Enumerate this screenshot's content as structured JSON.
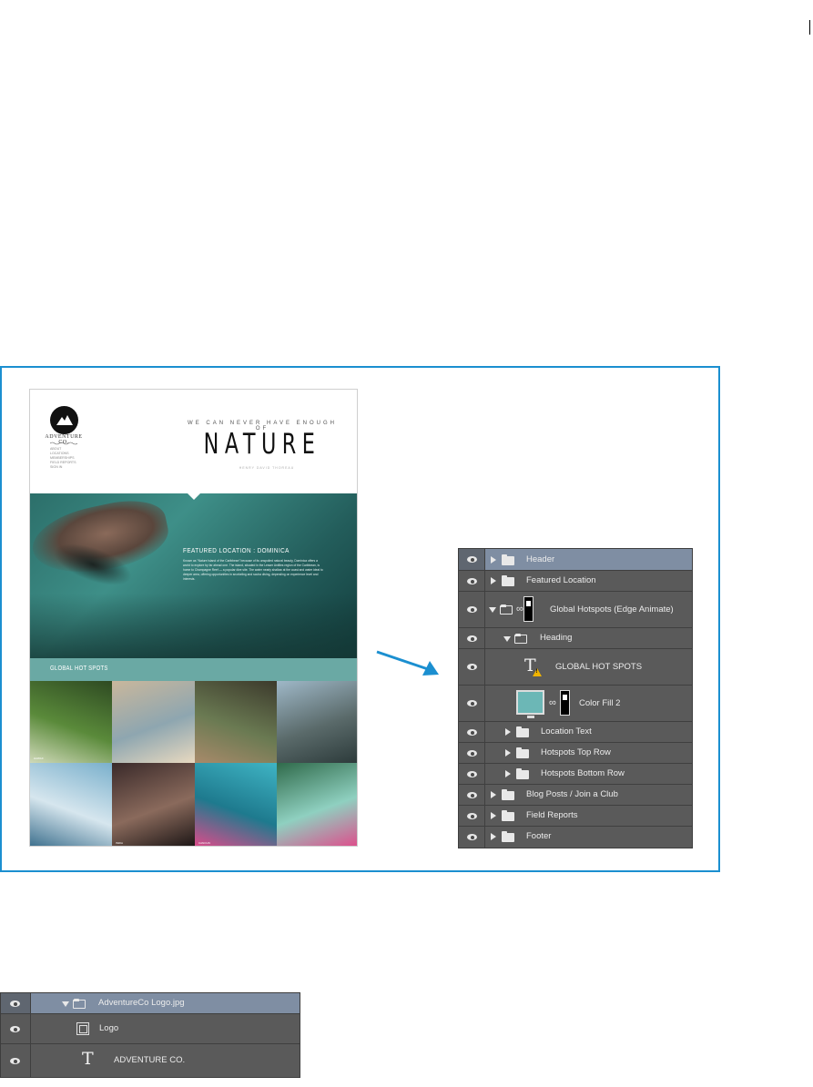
{
  "mockup": {
    "brand": "ADVENTURE CO.",
    "nav": [
      "ABOUT",
      "LOCATIONS",
      "MEMBERSHIPS",
      "FIELD REPORTS",
      "SIGN IN"
    ],
    "tagline": "WE CAN NEVER HAVE ENOUGH OF",
    "title": "NATURE",
    "subtitle": "HENRY DAVID THOREAU",
    "featured_title": "FEATURED LOCATION : DOMINICA",
    "featured_body": "Known as \"Nature Island of the Caribbean\" because of its unspoiled natural beauty, Dominica offers a world to explore by far ahead one. The island, situated in the Lesser Antilles region of the Caribbean, is home to Champagne Reef — a popular dive site. The water nearly shallow at the coast and water ideal to deeper area, offering opportunities in snorkeling and scuba diving, depending on experience level and interests.",
    "hot_spots_label": "GLOBAL HOT SPOTS",
    "tiles": [
      {
        "caption": "HAWAII",
        "colors": [
          "#2e4a22",
          "#5a8a3a",
          "#cfd9b8"
        ]
      },
      {
        "caption": "",
        "colors": [
          "#c9b79c",
          "#8ea6b0",
          "#e8d9c0"
        ]
      },
      {
        "caption": "",
        "colors": [
          "#3c3a2c",
          "#6a7a52",
          "#a88a6a"
        ]
      },
      {
        "caption": "",
        "colors": [
          "#9fb8c8",
          "#5a6a6a",
          "#2c3a3a"
        ]
      },
      {
        "caption": "",
        "colors": [
          "#7ab0cc",
          "#d6e6ee",
          "#3b6e8c"
        ]
      },
      {
        "caption": "INDIA",
        "colors": [
          "#3a2a2a",
          "#8a6a5c",
          "#1a1414"
        ]
      },
      {
        "caption": "CANCUN",
        "colors": [
          "#3fb4c4",
          "#1e7a8e",
          "#e04a8a"
        ]
      },
      {
        "caption": "",
        "colors": [
          "#2f6a4a",
          "#8fd0c0",
          "#e04a8a"
        ]
      }
    ]
  },
  "layers_panel": {
    "rows": [
      {
        "label": "Header",
        "indent": 0,
        "type": "folder",
        "expanded": false,
        "selected": true
      },
      {
        "label": "Featured Location",
        "indent": 0,
        "type": "folder",
        "expanded": false,
        "selected": false
      },
      {
        "label": "Global Hotspots (Edge Animate)",
        "indent": 0,
        "type": "folder-mask",
        "expanded": true,
        "selected": false
      },
      {
        "label": "Heading",
        "indent": 1,
        "type": "folder",
        "expanded": true,
        "selected": false
      },
      {
        "label": "GLOBAL HOT SPOTS",
        "indent": 2,
        "type": "text-warning",
        "expanded": false,
        "selected": false
      },
      {
        "label": "Color Fill 2",
        "indent": 2,
        "type": "fill-mask",
        "expanded": false,
        "selected": false
      },
      {
        "label": "Location Text",
        "indent": 1,
        "type": "folder",
        "expanded": false,
        "selected": false
      },
      {
        "label": "Hotspots Top Row",
        "indent": 1,
        "type": "folder",
        "expanded": false,
        "selected": false
      },
      {
        "label": "Hotspots Bottom Row",
        "indent": 1,
        "type": "folder",
        "expanded": false,
        "selected": false
      },
      {
        "label": "Blog Posts / Join a Club",
        "indent": 0,
        "type": "folder",
        "expanded": false,
        "selected": false
      },
      {
        "label": "Field Reports",
        "indent": 0,
        "type": "folder",
        "expanded": false,
        "selected": false
      },
      {
        "label": "Footer",
        "indent": 0,
        "type": "folder",
        "expanded": false,
        "selected": false
      }
    ]
  },
  "layers_panel_2": {
    "rows": [
      {
        "label": "AdventureCo Logo.jpg",
        "type": "folder",
        "selected": true
      },
      {
        "label": "Logo",
        "type": "smart-object",
        "selected": false
      },
      {
        "label": "ADVENTURE CO.",
        "type": "text",
        "selected": false
      }
    ]
  },
  "colors": {
    "frame_border": "#1b8fd0",
    "arrow": "#1b8fd0",
    "panel_bg": "#5a5a5a",
    "selected_row": "#7f8ea3",
    "hotspots_bar": "#6aa9a4",
    "warning": "#f0b400"
  }
}
